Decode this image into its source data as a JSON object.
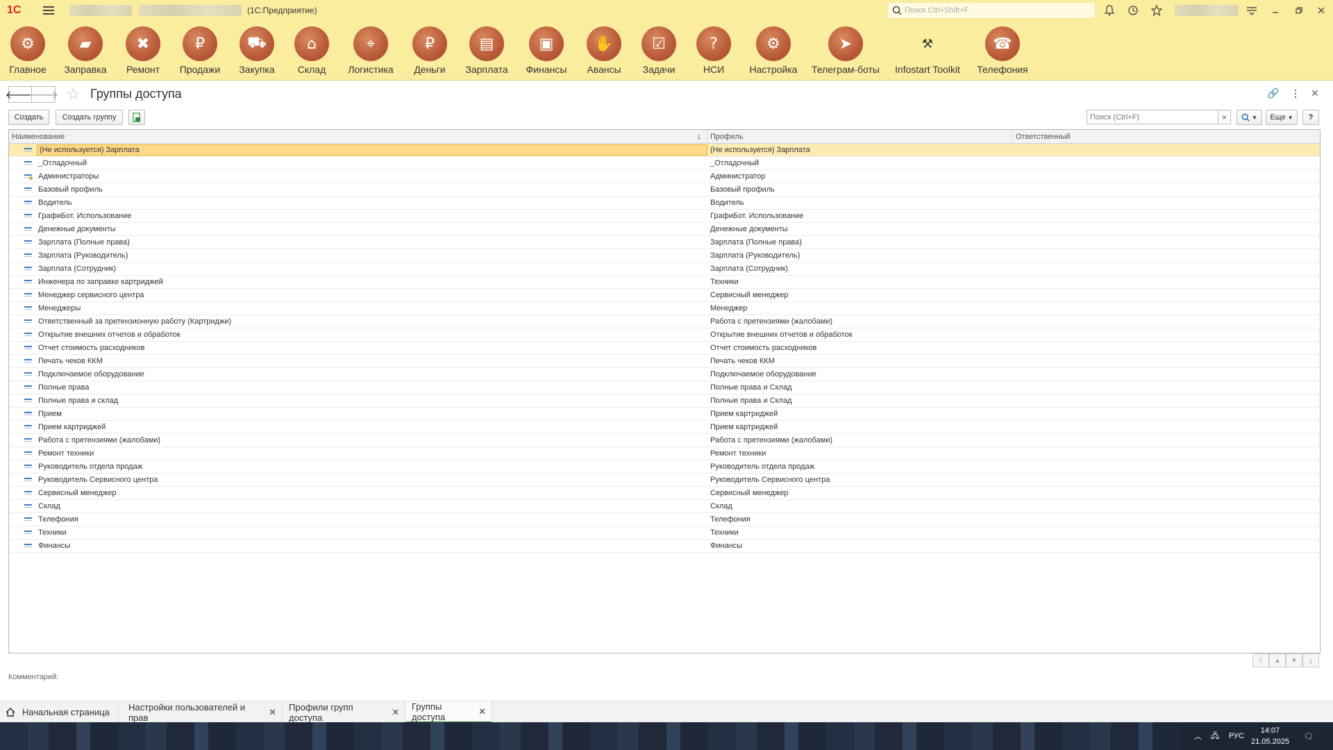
{
  "titlebar": {
    "app_title": "(1С:Предприятие)",
    "search_placeholder": "Поиск Ctrl+Shift+F"
  },
  "sections": [
    {
      "label": "Главное",
      "icon": "gear-icon"
    },
    {
      "label": "Заправка",
      "icon": "cartridge-icon"
    },
    {
      "label": "Ремонт",
      "icon": "tools-icon"
    },
    {
      "label": "Продажи",
      "icon": "sale-icon"
    },
    {
      "label": "Закупка",
      "icon": "cart-icon"
    },
    {
      "label": "Склад",
      "icon": "warehouse-icon"
    },
    {
      "label": "Логистика",
      "icon": "map-icon"
    },
    {
      "label": "Деньги",
      "icon": "money-bag-icon"
    },
    {
      "label": "Зарплата",
      "icon": "wallet-icon"
    },
    {
      "label": "Финансы",
      "icon": "briefcase-icon"
    },
    {
      "label": "Авансы",
      "icon": "hand-money-icon"
    },
    {
      "label": "Задачи",
      "icon": "checklist-icon"
    },
    {
      "label": "НСИ",
      "icon": "document-question-icon"
    },
    {
      "label": "Настройка",
      "icon": "settings-icon"
    },
    {
      "label": "Телеграм-боты",
      "icon": "telegram-icon"
    },
    {
      "label": "Infostart Toolkit",
      "icon": "toolkit-icon"
    },
    {
      "label": "Телефония",
      "icon": "telephone-icon"
    }
  ],
  "form": {
    "title": "Группы доступа"
  },
  "commands": {
    "create": "Создать",
    "create_group": "Создать группу",
    "search_placeholder": "Поиск (Ctrl+F)",
    "more": "Еще",
    "help": "?"
  },
  "table": {
    "columns": [
      "Наименование",
      "Профиль",
      "Ответственный"
    ],
    "rows": [
      {
        "name": "(Не используется) Зарплата",
        "profile": "(Не используется) Зарплата",
        "responsible": ""
      },
      {
        "name": "_Отладочный",
        "profile": "_Отладочный",
        "responsible": ""
      },
      {
        "name": "Администраторы",
        "profile": "Администратор",
        "responsible": ""
      },
      {
        "name": "Базовый профиль",
        "profile": "Базовый профиль",
        "responsible": ""
      },
      {
        "name": "Водитель",
        "profile": "Водитель",
        "responsible": ""
      },
      {
        "name": "ГрафиБот. Использование",
        "profile": "ГрафиБот. Использование",
        "responsible": ""
      },
      {
        "name": "Денежные документы",
        "profile": "Денежные документы",
        "responsible": ""
      },
      {
        "name": "Зарплата (Полные права)",
        "profile": "Зарплата (Полные права)",
        "responsible": ""
      },
      {
        "name": "Зарплата (Руководитель)",
        "profile": "Зарплата (Руководитель)",
        "responsible": ""
      },
      {
        "name": "Зарплата (Сотрудник)",
        "profile": "Зарплата (Сотрудник)",
        "responsible": ""
      },
      {
        "name": "Инженера по заправке картриджей",
        "profile": "Техники",
        "responsible": ""
      },
      {
        "name": "Менеджер сервисного центра",
        "profile": "Сервисный менеджер",
        "responsible": ""
      },
      {
        "name": "Менеджеры",
        "profile": "Менеджер",
        "responsible": ""
      },
      {
        "name": "Ответственный за претензионную работу (Картриджи)",
        "profile": "Работа с претензиями (жалобами)",
        "responsible": ""
      },
      {
        "name": "Открытие внешних отчетов и обработок",
        "profile": "Открытие внешних отчетов и обработок",
        "responsible": ""
      },
      {
        "name": "Отчет стоимость расходников",
        "profile": "Отчет стоимость расходников",
        "responsible": ""
      },
      {
        "name": "Печать чеков ККМ",
        "profile": "Печать чеков ККМ",
        "responsible": ""
      },
      {
        "name": "Подключаемое оборудование",
        "profile": "Подключаемое оборудование",
        "responsible": ""
      },
      {
        "name": "Полные права",
        "profile": "Полные права и Склад",
        "responsible": ""
      },
      {
        "name": "Полные права и склад",
        "profile": "Полные права и Склад",
        "responsible": ""
      },
      {
        "name": "Прием",
        "profile": "Прием картриджей",
        "responsible": ""
      },
      {
        "name": "Прием картриджей",
        "profile": "Прием картриджей",
        "responsible": ""
      },
      {
        "name": "Работа с претензиями (жалобами)",
        "profile": "Работа с претензиями (жалобами)",
        "responsible": ""
      },
      {
        "name": "Ремонт техники",
        "profile": "Ремонт техники",
        "responsible": ""
      },
      {
        "name": "Руководитель отдела продаж",
        "profile": "Руководитель отдела продаж",
        "responsible": ""
      },
      {
        "name": "Руководитель Сервисного центра",
        "profile": "Руководитель Сервисного центра",
        "responsible": ""
      },
      {
        "name": "Сервисный менеджер",
        "profile": "Сервисный менеджер",
        "responsible": ""
      },
      {
        "name": "Склад",
        "profile": "Склад",
        "responsible": ""
      },
      {
        "name": "Телефония",
        "profile": "Телефония",
        "responsible": ""
      },
      {
        "name": "Техники",
        "profile": "Техники",
        "responsible": ""
      },
      {
        "name": "Финансы",
        "profile": "Финансы",
        "responsible": ""
      }
    ]
  },
  "comment_label": "Комментарий:",
  "open_windows": [
    {
      "label": "Начальная страница",
      "closable": false
    },
    {
      "label": "Настройки пользователей и прав",
      "closable": true
    },
    {
      "label": "Профили групп доступа",
      "closable": true
    },
    {
      "label": "Группы доступа",
      "closable": true,
      "active": true
    }
  ],
  "taskbar": {
    "language": "РУС",
    "time": "14:07",
    "date": "21.05.2025"
  }
}
